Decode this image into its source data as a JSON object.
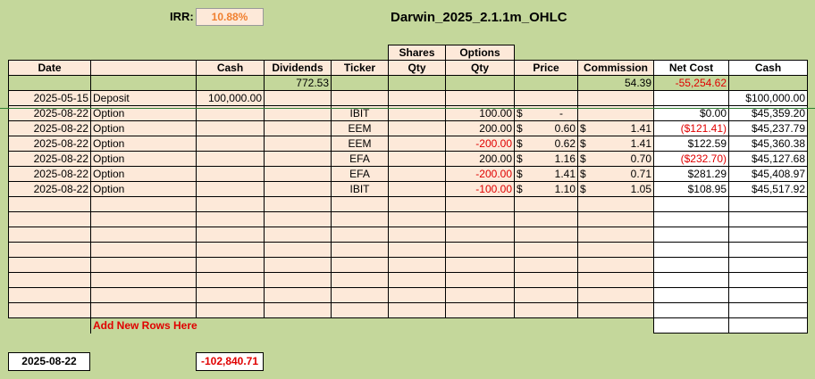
{
  "irr": {
    "label": "IRR:",
    "value": "10.88%"
  },
  "title": "Darwin_2025_2.1.1m_OHLC",
  "header_top": {
    "shares": "Shares",
    "options": "Options"
  },
  "headers": [
    "Date",
    "",
    "Cash",
    "Dividends",
    "Ticker",
    "Qty",
    "Qty",
    "Price",
    "Commission",
    "Net Cost",
    "Cash"
  ],
  "totals": {
    "dividends": "772.53",
    "commission": "54.39",
    "net_cost": "-55,254.62"
  },
  "rows": [
    {
      "date": "2025-05-15",
      "type": "Deposit",
      "cash": "100,000.00",
      "ticker": "",
      "opt_qty": "",
      "price": "",
      "commission": "",
      "net_cost": "",
      "balance": "$100,000.00"
    },
    {
      "date": "2025-08-22",
      "type": "Option",
      "cash": "",
      "ticker": "IBIT",
      "opt_qty": "100.00",
      "price": "-",
      "commission": "",
      "net_cost": "$0.00",
      "balance": "$45,359.20"
    },
    {
      "date": "2025-08-22",
      "type": "Option",
      "cash": "",
      "ticker": "EEM",
      "opt_qty": "200.00",
      "price": "0.60",
      "commission": "1.41",
      "net_cost": "($121.41)",
      "balance": "$45,237.79"
    },
    {
      "date": "2025-08-22",
      "type": "Option",
      "cash": "",
      "ticker": "EEM",
      "opt_qty": "-200.00",
      "price": "0.62",
      "commission": "1.41",
      "net_cost": "$122.59",
      "balance": "$45,360.38"
    },
    {
      "date": "2025-08-22",
      "type": "Option",
      "cash": "",
      "ticker": "EFA",
      "opt_qty": "200.00",
      "price": "1.16",
      "commission": "0.70",
      "net_cost": "($232.70)",
      "balance": "$45,127.68"
    },
    {
      "date": "2025-08-22",
      "type": "Option",
      "cash": "",
      "ticker": "EFA",
      "opt_qty": "-200.00",
      "price": "1.41",
      "commission": "0.71",
      "net_cost": "$281.29",
      "balance": "$45,408.97"
    },
    {
      "date": "2025-08-22",
      "type": "Option",
      "cash": "",
      "ticker": "IBIT",
      "opt_qty": "-100.00",
      "price": "1.10",
      "commission": "1.05",
      "net_cost": "$108.95",
      "balance": "$45,517.92"
    }
  ],
  "currency_symbol": "$",
  "add_rows_label": "Add New Rows Here",
  "bottom": {
    "date": "2025-08-22",
    "total": "-102,840.71"
  },
  "colors": {
    "background": "#c4d79b",
    "cell_peach": "#fde9d9",
    "negative": "#e00000",
    "irr_text": "#f08030"
  }
}
